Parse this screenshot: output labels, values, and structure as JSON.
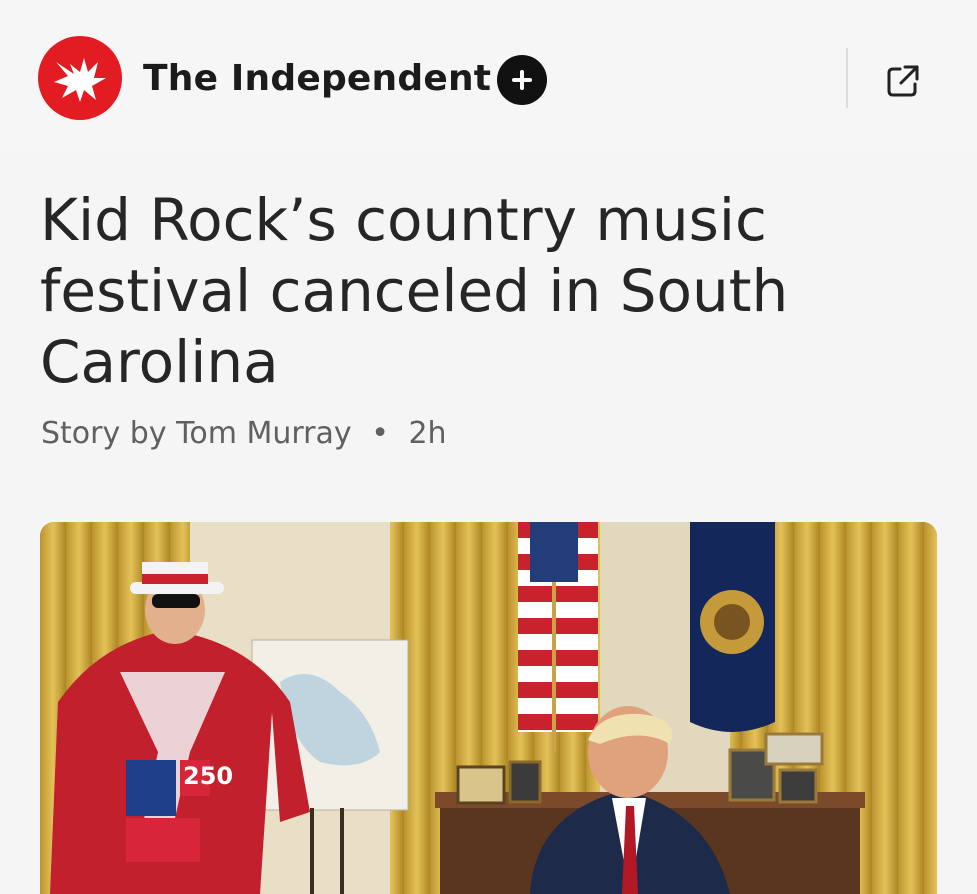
{
  "header": {
    "publisher_name": "The Independent",
    "logo_icon": "eagle-icon",
    "follow_icon": "plus-icon",
    "share_icon": "open-external-icon",
    "brand_color": "#e31b23"
  },
  "article": {
    "headline": "Kid Rock’s country music festival canceled in South Carolina",
    "byline_prefix": "Story by",
    "author": "Tom Murray",
    "separator": "•",
    "time_ago": "2h"
  },
  "hero_image": {
    "sign_text": "250"
  }
}
